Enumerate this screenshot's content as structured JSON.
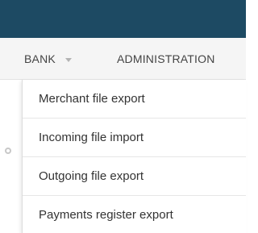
{
  "navbar": {
    "items": [
      {
        "label": "BANK"
      },
      {
        "label": "ADMINISTRATION"
      }
    ]
  },
  "dropdown": {
    "items": [
      {
        "label": "Merchant file export"
      },
      {
        "label": "Incoming file import"
      },
      {
        "label": "Outgoing file export"
      },
      {
        "label": "Payments register export"
      }
    ]
  },
  "icons": {
    "bank_caret": "chevron-down-icon",
    "side": "gear-icon"
  },
  "colors": {
    "topbar": "#1d4a63",
    "navbar": "#f5f5f5",
    "menu_text": "#333333"
  }
}
